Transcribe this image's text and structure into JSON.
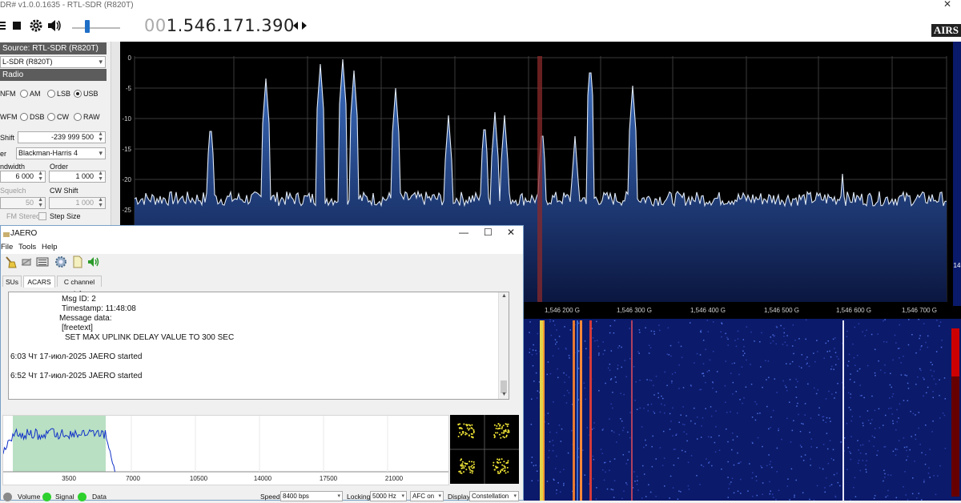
{
  "window": {
    "title": "DR# v1.0.0.1635 - RTL-SDR (R820T)",
    "close": "✕"
  },
  "toolbar": {
    "freq_dim": "00",
    "freq_main": "1.546.171.390",
    "logo": "AIRS"
  },
  "left_panel": {
    "source_header": "Source: RTL-SDR (R820T)",
    "source_value": "L-SDR (R820T)",
    "radio_header": "Radio",
    "modes_row1": [
      "NFM",
      "AM",
      "LSB",
      "USB"
    ],
    "modes_row2": [
      "WFM",
      "DSB",
      "CW",
      "RAW"
    ],
    "selected_mode": "USB",
    "shift_label": "Shift",
    "shift_value": "-239 999 500",
    "filter_label": "er",
    "filter_value": "Blackman-Harris 4",
    "bandwidth_label": "ndwidth",
    "bandwidth_value": "6 000",
    "order_label": "Order",
    "order_value": "1 000",
    "squelch_label": "Squelch",
    "squelch_value": "50",
    "cwshift_label": "CW Shift",
    "cwshift_value": "1 000",
    "fmstereo_label": "FM Stereo",
    "stepsize_label": "Step Size"
  },
  "spectrum": {
    "y_ticks": [
      "0",
      "-5",
      "-10",
      "-15",
      "-20",
      "-25"
    ],
    "x_ticks": [
      "1,546 200 G",
      "1,546 300 G",
      "1,546 400 G",
      "1,546 500 G",
      "1,546 600 G",
      "1,546 700 G"
    ],
    "right_label": "14",
    "fill_color": "#2a5cab",
    "line_color": "#dfe8f4",
    "vfo_color": "#8a2a2a"
  },
  "jaero": {
    "title": "JAERO",
    "menu": [
      "File",
      "Tools",
      "Help"
    ],
    "toolbar_icons": [
      "broom-icon",
      "satellite-icon",
      "keyboard-icon",
      "gear-icon",
      "document-icon",
      "speaker-icon"
    ],
    "tabs": [
      "SUs",
      "ACARS",
      "C channel info"
    ],
    "active_tab": "ACARS",
    "lines": [
      "Msg ID: 2",
      "Timestamp: 11:48:08",
      "Message data:",
      "[freetext]",
      "SET MAX UPLINK DELAY VALUE TO 300 SEC",
      "6:03 Чт 17-июл-2025 JAERO started",
      "6:52 Чт 17-июл-2025 JAERO started"
    ],
    "plot_ticks": [
      "3500",
      "7000",
      "10500",
      "14000",
      "17500",
      "21000"
    ],
    "status": {
      "volume": "Volume",
      "signal": "Signal",
      "data": "Data",
      "speed_label": "Speed",
      "speed_value": "8400 bps",
      "locking_label": "Locking",
      "locking_value": "5000 Hz",
      "afc_value": "AFC on",
      "display_label": "Display",
      "display_value": "Constellation"
    }
  }
}
